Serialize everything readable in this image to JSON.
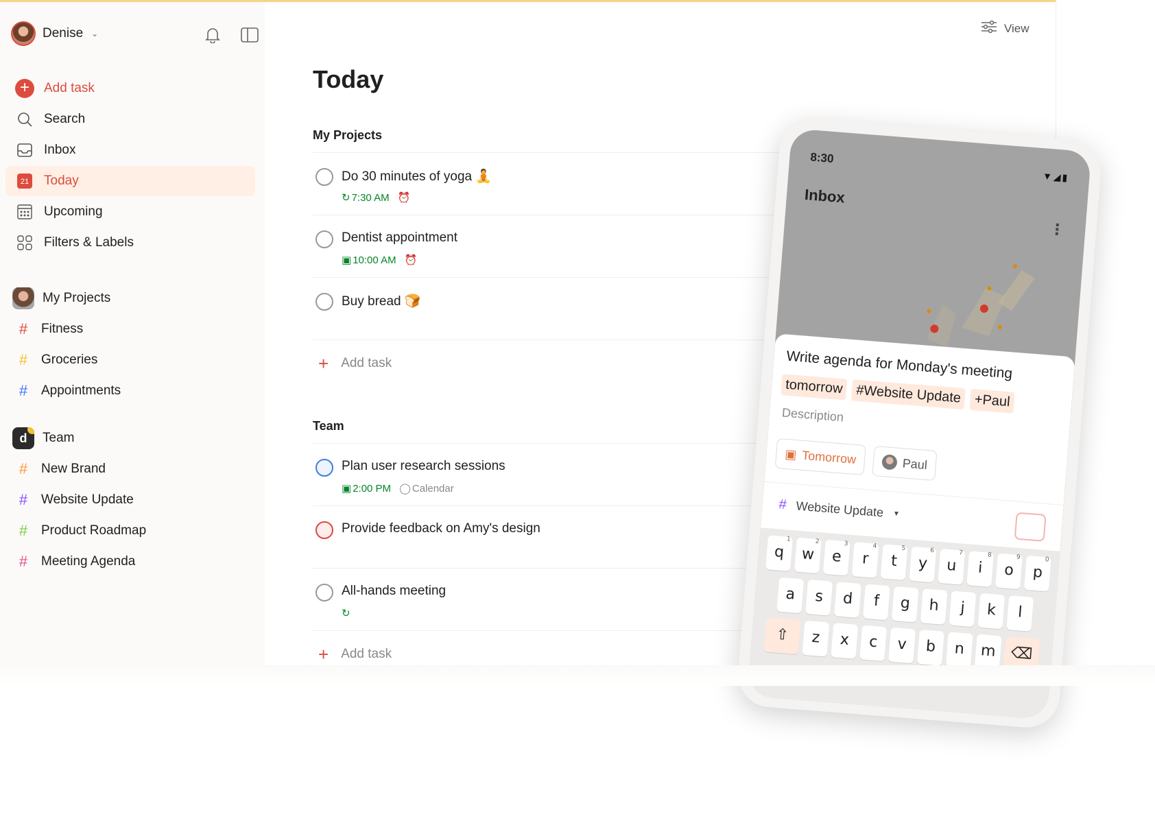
{
  "user": {
    "name": "Denise"
  },
  "sidebar": {
    "nav": [
      {
        "label": "Add task",
        "icon": "add-circle-icon"
      },
      {
        "label": "Search",
        "icon": "search-icon"
      },
      {
        "label": "Inbox",
        "icon": "inbox-icon"
      },
      {
        "label": "Today",
        "icon": "calendar-today-icon",
        "day": "21"
      },
      {
        "label": "Upcoming",
        "icon": "calendar-grid-icon"
      },
      {
        "label": "Filters & Labels",
        "icon": "filters-icon"
      }
    ],
    "my_projects": {
      "label": "My Projects",
      "items": [
        {
          "label": "Fitness",
          "color": "#dc4c3e"
        },
        {
          "label": "Groceries",
          "color": "#f1c232"
        },
        {
          "label": "Appointments",
          "color": "#4073ff"
        }
      ]
    },
    "team": {
      "label": "Team",
      "avatar_letter": "d",
      "items": [
        {
          "label": "New Brand",
          "color": "#ff9933"
        },
        {
          "label": "Website Update",
          "color": "#884dff"
        },
        {
          "label": "Product Roadmap",
          "color": "#7ecc49"
        },
        {
          "label": "Meeting Agenda",
          "color": "#e05194"
        }
      ]
    }
  },
  "main": {
    "view_label": "View",
    "title": "Today",
    "sections": [
      {
        "title": "My Projects",
        "tasks": [
          {
            "title": "Do 30 minutes of yoga",
            "emoji": "🧘",
            "time": "7:30 AM",
            "recurring": true,
            "alarm": true
          },
          {
            "title": "Dentist appointment",
            "time": "10:00 AM",
            "alarm": true
          },
          {
            "title": "Buy bread",
            "emoji": "🍞"
          }
        ],
        "add_label": "Add task"
      },
      {
        "title": "Team",
        "tasks": [
          {
            "title": "Plan user research sessions",
            "time": "2:00 PM",
            "calendar": "Calendar",
            "priority": "blue"
          },
          {
            "title": "Provide feedback on Amy's design",
            "priority": "red"
          },
          {
            "title": "All-hands meeting",
            "recurring": true
          }
        ],
        "add_label": "Add task"
      }
    ]
  },
  "phone": {
    "time": "8:30",
    "screen_title": "Inbox",
    "task_input": "Write agenda for Monday's meeting",
    "chips": [
      "tomorrow",
      "#Website Update",
      "+Paul"
    ],
    "description_placeholder": "Description",
    "date_pill": "Tomorrow",
    "assignee_pill": "Paul",
    "project": "Website Update",
    "keyboard": {
      "row1": [
        [
          "q",
          "1"
        ],
        [
          "w",
          "2"
        ],
        [
          "e",
          "3"
        ],
        [
          "r",
          "4"
        ],
        [
          "t",
          "5"
        ],
        [
          "y",
          "6"
        ],
        [
          "u",
          "7"
        ],
        [
          "i",
          "8"
        ],
        [
          "o",
          "9"
        ],
        [
          "p",
          "0"
        ]
      ],
      "row2": [
        "a",
        "s",
        "d",
        "f",
        "g",
        "h",
        "j",
        "k",
        "l"
      ],
      "row3": [
        "z",
        "x",
        "c",
        "v",
        "b",
        "n",
        "m"
      ]
    }
  }
}
